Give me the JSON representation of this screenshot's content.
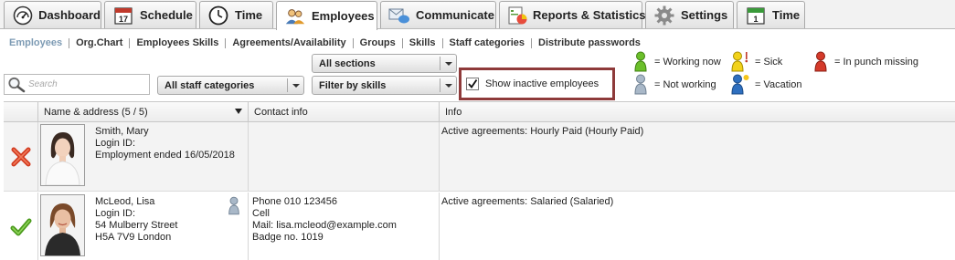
{
  "tabs": [
    {
      "label": "Dashboard",
      "icon": "dashboard-gauge-icon"
    },
    {
      "label": "Schedule",
      "icon": "calendar-17-icon"
    },
    {
      "label": "Time",
      "icon": "clock-icon"
    },
    {
      "label": "Employees",
      "icon": "employees-people-icon",
      "active": true
    },
    {
      "label": "Communicate",
      "icon": "envelope-speech-icon"
    },
    {
      "label": "Reports & Statistics",
      "icon": "report-chart-icon"
    },
    {
      "label": "Settings",
      "icon": "gear-icon"
    },
    {
      "label": "Time",
      "icon": "calendar-1-icon"
    }
  ],
  "subnav": [
    "Employees",
    "Org.Chart",
    "Employees Skills",
    "Agreements/Availability",
    "Groups",
    "Skills",
    "Staff categories",
    "Distribute passwords"
  ],
  "filters": {
    "search_placeholder": "Search",
    "staff_categories": "All staff categories",
    "sections": "All sections",
    "skills": "Filter by skills",
    "show_inactive_label": "Show inactive employees",
    "show_inactive_checked": true
  },
  "legend": {
    "working_now": "= Working now",
    "not_working": "= Not working",
    "sick": "= Sick",
    "vacation": "= Vacation",
    "in_punch_missing": "= In punch missing"
  },
  "table": {
    "columns": {
      "name": "Name & address (5 / 5)",
      "contact": "Contact info",
      "info": "Info"
    },
    "rows": [
      {
        "status": "inactive",
        "status_icon": "red-x-icon",
        "name": "Smith, Mary",
        "login": "Login ID:",
        "extra1": "Employment ended 16/05/2018",
        "extra2": "",
        "contact": [
          "",
          "",
          "",
          ""
        ],
        "info": "Active agreements: Hourly Paid (Hourly Paid)"
      },
      {
        "status": "active",
        "status_icon": "green-check-icon",
        "name": "McLeod, Lisa",
        "login": "Login ID:",
        "extra1": "54 Mulberry Street",
        "extra2": "H5A 7V9 London",
        "presence_icon": "not-working-pawn-icon",
        "contact": [
          "Phone 010 123456",
          "Cell",
          "Mail: lisa.mcleod@example.com",
          "Badge no. 1019"
        ],
        "info": "Active agreements: Salaried (Salaried)"
      }
    ]
  },
  "colors": {
    "pawn_green": "#6bbf2a",
    "pawn_grey": "#a9b8c8",
    "pawn_yellow": "#f2d21a",
    "pawn_red": "#d43a2a",
    "pawn_blue": "#2e6fbf",
    "highlight_border": "#8e3a3a"
  }
}
